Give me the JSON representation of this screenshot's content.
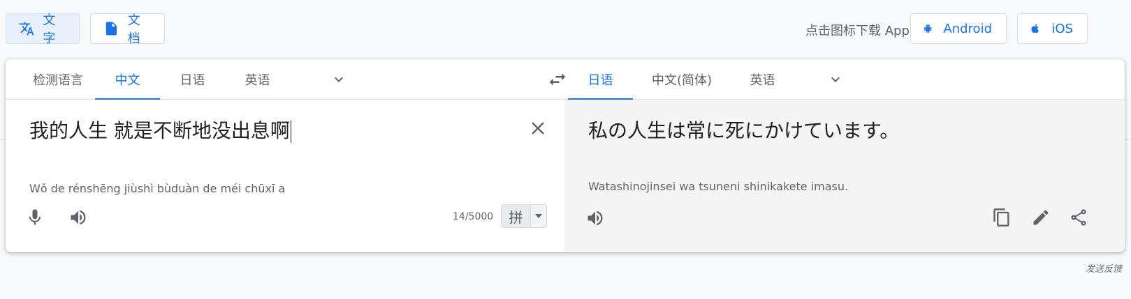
{
  "top_bar": {
    "text_mode_label": "文字",
    "doc_mode_label": "文档",
    "app_download_text": "点击图标下载 App",
    "android_label": "Android",
    "ios_label": "iOS"
  },
  "source_langs": {
    "tabs": [
      {
        "label": "检测语言"
      },
      {
        "label": "中文",
        "active": true
      },
      {
        "label": "日语"
      },
      {
        "label": "英语"
      }
    ]
  },
  "target_langs": {
    "tabs": [
      {
        "label": "日语",
        "active": true
      },
      {
        "label": "中文(简体)"
      },
      {
        "label": "英语"
      }
    ]
  },
  "source": {
    "text": "我的人生 就是不断地没出息啊",
    "romanization": "Wǒ de rénshēng jiùshì bùduàn de méi chūxī a",
    "char_count": "14/5000",
    "ime_key": "拼"
  },
  "target": {
    "text": "私の人生は常に死にかけています。",
    "romanization": "Watashinojinsei wa tsuneni shinikakete imasu."
  },
  "footer": {
    "feedback_label": "发送反馈"
  },
  "colors": {
    "accent": "#1a73e8",
    "target_bg": "#f5f5f5"
  }
}
